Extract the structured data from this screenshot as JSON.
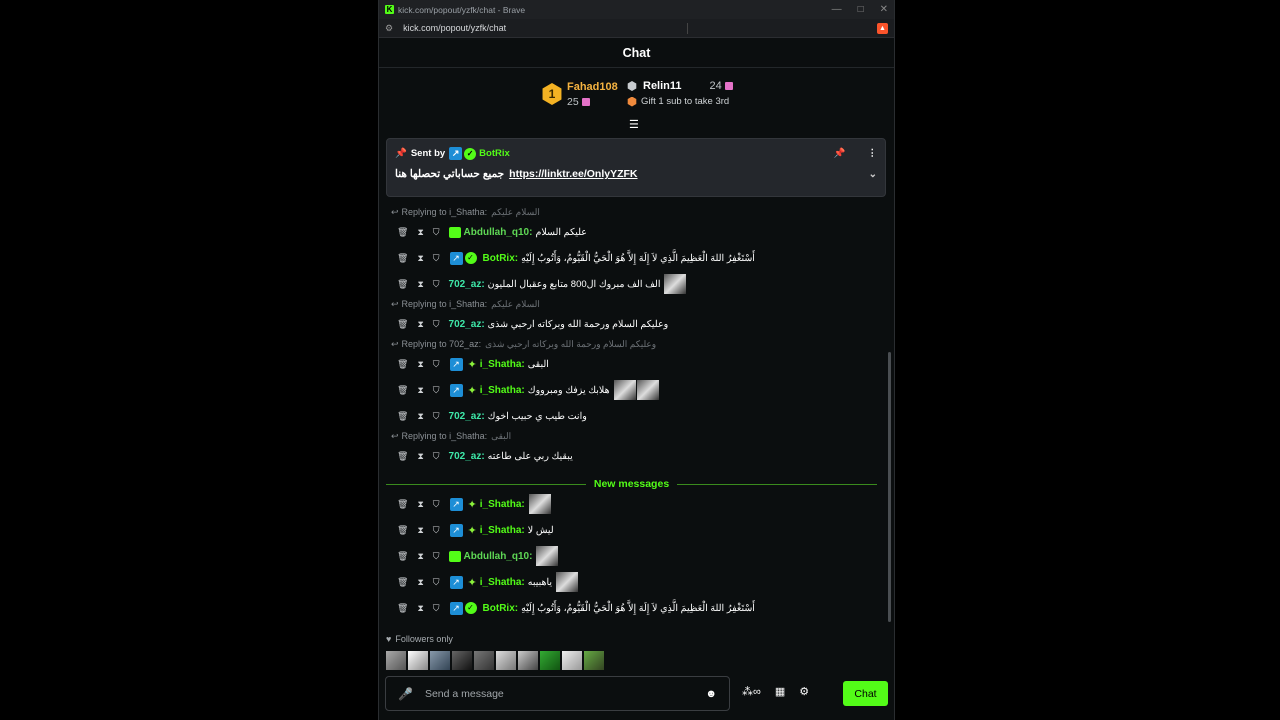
{
  "browser": {
    "title": "kick.com/popout/yzfk/chat - Brave",
    "url": "kick.com/popout/yzfk/chat"
  },
  "header": {
    "title": "Chat"
  },
  "leaderboard": {
    "first": {
      "rank": "1",
      "name": "Fahad108",
      "count": "25"
    },
    "second": {
      "name": "Relin11",
      "count": "24",
      "note": "Gift 1 sub to take 3rd"
    }
  },
  "pinned": {
    "sent_by": "Sent by",
    "user": "BotRix",
    "text": "جميع حساباتي تحصلها هنا",
    "link": "https://linktr.ee/OnlyYZFK"
  },
  "messages": [
    {
      "reply": "Replying to i_Shatha:",
      "reply_quote": "السلام عليكم",
      "user": "Abdullah_q10:",
      "text": "عليكم السلام"
    },
    {
      "user": "BotRix:",
      "text": "أَسْتَغْفِرُ اللهَ الْعَظِيمَ الَّذِي لاَ إِلَهَ إِلاَّ هُوَ الْحَيُّ الْقَيُّومُ، وَأَتُوبُ إِلَيْهِ"
    },
    {
      "user": "702_az:",
      "text": "الف الف مبروك ال800 متابع وعقبال المليون"
    },
    {
      "reply": "Replying to i_Shatha:",
      "reply_quote": "السلام عليكم",
      "user": "702_az:",
      "text": "وعليكم السلام ورحمة الله وبركاته ارحبي شذى"
    },
    {
      "reply": "Replying to 702_az:",
      "reply_quote": "وعليكم السلام ورحمة الله وبركاته ارحبي شذى",
      "user": "i_Shatha:",
      "text": "البقى"
    },
    {
      "user": "i_Shatha:",
      "text": "هلابك يزفك ومبرووك"
    },
    {
      "user": "702_az:",
      "text": "وانت طيب ي حبيب اخوك"
    },
    {
      "reply": "Replying to i_Shatha:",
      "reply_quote": "البقى",
      "user": "702_az:",
      "text": "يبقيك ربي على طاعته"
    }
  ],
  "new_messages_label": "New messages",
  "new_messages": [
    {
      "user": "i_Shatha:",
      "text": ""
    },
    {
      "user": "i_Shatha:",
      "text": "ليش لا"
    },
    {
      "user": "Abdullah_q10:",
      "text": ""
    },
    {
      "user": "i_Shatha:",
      "text": "ياهبيبه"
    },
    {
      "user": "BotRix:",
      "text": "أَسْتَغْفِرُ اللهَ الْعَظِيمَ الَّذِي لاَ إِلَهَ إِلاَّ هُوَ الْحَيُّ الْقَيُّومُ، وَأَتُوبُ إِلَيْهِ"
    }
  ],
  "footer": {
    "followers_only": "Followers only",
    "placeholder": "Send a message",
    "chat_button": "Chat"
  },
  "colors": {
    "accent": "#53fc18",
    "background": "#0b0e0f"
  }
}
